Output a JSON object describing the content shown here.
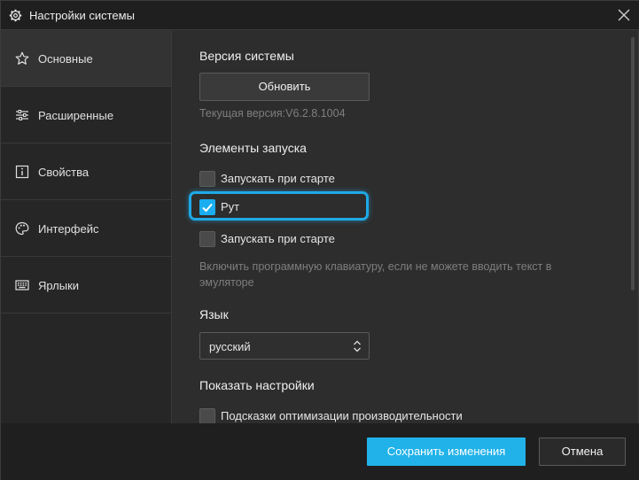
{
  "window": {
    "title": "Настройки системы",
    "title_icon": "gear-icon",
    "close_icon": "close-icon"
  },
  "sidebar": {
    "items": [
      {
        "label": "Основные",
        "icon": "star-icon",
        "active": true
      },
      {
        "label": "Расширенные",
        "icon": "sliders-icon",
        "active": false
      },
      {
        "label": "Свойства",
        "icon": "info-icon",
        "active": false
      },
      {
        "label": "Интерфейс",
        "icon": "palette-icon",
        "active": false
      },
      {
        "label": "Ярлыки",
        "icon": "keyboard-icon",
        "active": false
      }
    ]
  },
  "main": {
    "version_section": {
      "title": "Версия системы",
      "update_button": "Обновить",
      "current_version": "Текущая версия:V6.2.8.1004"
    },
    "startup_section": {
      "title": "Элементы запуска",
      "options": [
        {
          "label": "Запускать при старте",
          "checked": false
        },
        {
          "label": "Рут",
          "checked": true
        },
        {
          "label": "Запускать при старте",
          "checked": false
        }
      ],
      "hint": "Включить программную клавиатуру, если не можете вводить текст в эмуляторе"
    },
    "language_section": {
      "title": "Язык",
      "selected": "русский"
    },
    "display_section": {
      "title": "Показать настройки",
      "options": [
        {
          "label": "Подсказки оптимизации производительности",
          "checked": false
        }
      ]
    }
  },
  "footer": {
    "save_button": "Сохранить изменения",
    "cancel_button": "Отмена"
  },
  "colors": {
    "accent": "#20b2e8",
    "highlight": "#1fa9e6",
    "background": "#2d2d2d",
    "titlebar": "#1f1f1f"
  }
}
